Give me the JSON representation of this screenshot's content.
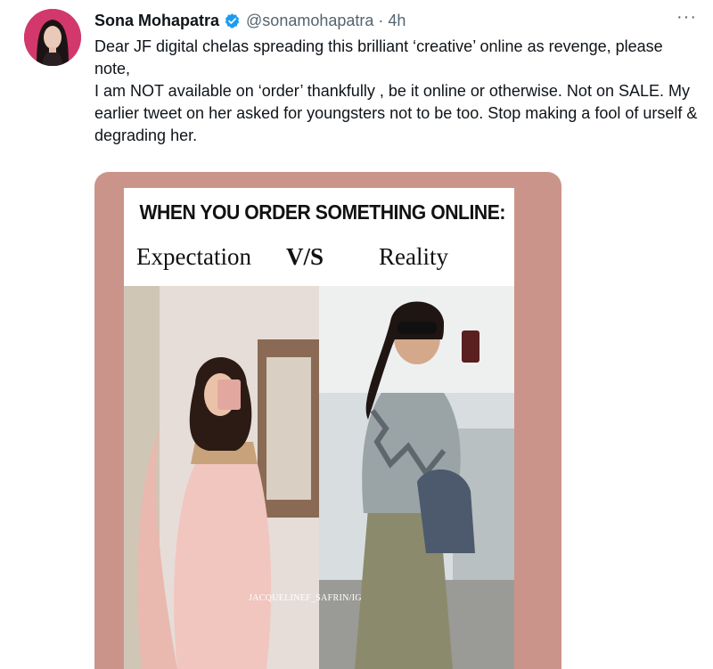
{
  "tweet": {
    "display_name": "Sona Mohapatra",
    "handle": "@sonamohapatra",
    "separator": "·",
    "time": "4h",
    "more_label": "···",
    "text_lines": [
      "Dear JF digital chelas spreading this brilliant ‘creative’ online as revenge, please note,",
      "I am NOT available on ‘order’ thankfully , be it online or otherwise. Not on SALE. My earlier tweet on her asked for youngsters not to be too. Stop making a fool of urself & degrading her."
    ]
  },
  "icons": {
    "verified": "verified-badge-icon",
    "more": "more-options-icon"
  },
  "media": {
    "meme_title": "WHEN YOU ORDER SOMETHING ONLINE:",
    "left_label": "Expectation",
    "middle_label": "V/S",
    "right_label": "Reality",
    "watermark": "JACQUELINEF_SAFRIN/IG"
  },
  "colors": {
    "verified_blue": "#1d9bf0",
    "secondary_text": "#536471",
    "media_background": "#cb948b"
  }
}
